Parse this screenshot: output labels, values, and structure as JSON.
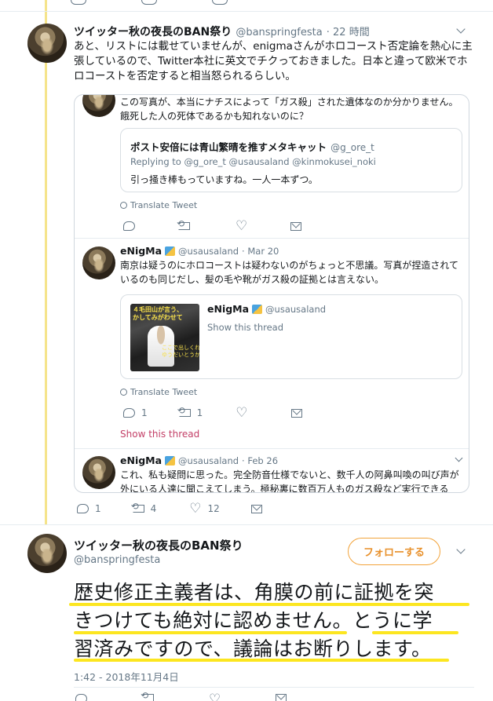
{
  "tweet1": {
    "name": "ツイッター秋の夜長のBAN祭り",
    "handle": "@banspringfesta",
    "time": "· 22 時間",
    "body": "あと、リストには載せていませんが、enigmaさんがホロコースト否定論を熱心に主張しているので、Twitter本社に英文でチクっておきました。日本と違って欧米でホロコーストを否定すると相当怒られるらしい。",
    "quoted": {
      "tweet_a": {
        "body": "この写真が、本当にナチスによって「ガス殺」された遺体なのか分かりません。餓死した人の死体であるかも知れないのに？",
        "card": {
          "name": "ポスト安倍には青山繁晴を推すメタキャット",
          "handle": "@g_ore_t",
          "replying": "Replying to @g_ore_t @usausaland @kinmokusei_noki",
          "body": "引っ掻き棒もっていますね。一人一本ずつ。"
        },
        "translate": "Translate Tweet"
      },
      "tweet_b": {
        "name": "eNigMa",
        "handle": "@usausaland",
        "time": "· Mar 20",
        "body": "南京は疑うのにホロコーストは疑わないのがちょっと不思議。写真が捏造されているのも同じだし、髪の毛や靴がガス殺の証拠とは言えない。",
        "card": {
          "name": "eNigMa",
          "handle": "@usausaland",
          "show": "Show this thread",
          "thumb_text_top": "４毛田山が言う、\nかしてみがわせて",
          "thumb_text_bottom": "ここで出しくれ\nゆうだいとうか"
        },
        "translate": "Translate Tweet",
        "reply_count": "1",
        "retweet_count": "1",
        "show_thread": "Show this thread"
      },
      "tweet_c": {
        "name": "eNigMa",
        "handle": "@usausaland",
        "time": "· Feb 26",
        "body": "これ、私も疑問に思った。完全防音仕様でないと、数千人の阿鼻叫喚の叫び声が外にいる人達に聞こえてしまう。極秘裏に数百万人ものガス殺など実行できる"
      }
    },
    "reply_count": "1",
    "retweet_count": "4",
    "like_count": "12"
  },
  "tweet2": {
    "name": "ツイッター秋の夜長のBAN祭り",
    "handle": "@banspringfesta",
    "follow_label": "フォローする",
    "body_lines": [
      "歴史修正主義者は、角膜の前に証拠を突",
      "きつけても絶対に認めません。とうに学",
      "習済みですので、議論はお断りします。"
    ],
    "timestamp": "1:42 - 2018年11月4日"
  },
  "colors": {
    "accent": "#f2a33a",
    "highlight": "#fce620",
    "thread_line": "#f5e48b",
    "show_thread": "#c33f67"
  }
}
